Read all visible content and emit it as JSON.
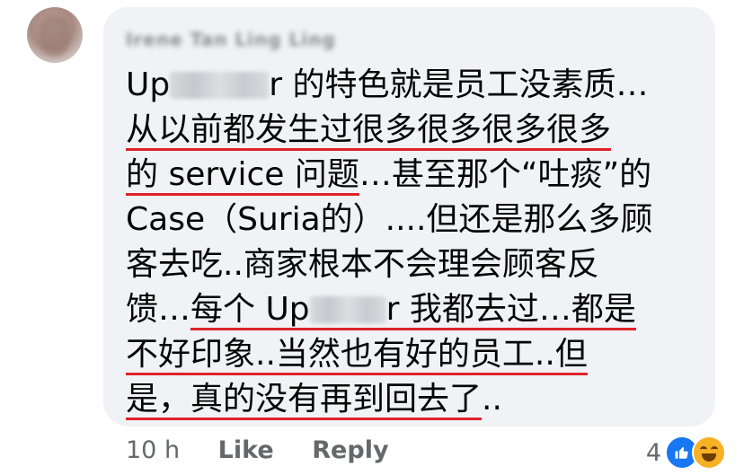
{
  "comment": {
    "author": "Irene Tan Ling Ling",
    "lines": [
      {
        "pre": "Up",
        "post": "r 的特色就是员工没素质…"
      },
      {
        "text": "从以前都发生过很多很多很多很多"
      },
      {
        "u": "的 service 问题",
        "rest": "…甚至那个“吐痰”的"
      },
      {
        "text": "Case（Suria的）....但还是那么多顾"
      },
      {
        "text": "客去吃..商家根本不会理会顾客反"
      },
      {
        "pre": "馈…",
        "u1": "每个 Up",
        "u2": "r 我都去过…都是"
      },
      {
        "u": "不好印象..当然也有好的员工..但",
        "rest": ""
      },
      {
        "u": "是，真的没有再到回去了",
        "rest": ".."
      }
    ]
  },
  "footer": {
    "time": "10 h",
    "like": "Like",
    "reply": "Reply"
  },
  "reactions": {
    "count": "4",
    "icons": [
      "like-icon",
      "haha-icon"
    ]
  },
  "colors": {
    "bubble": "#f0f2f5",
    "underline": "#e0222a",
    "meta": "#65676b",
    "like_blue": "#1877f2",
    "haha_yellow": "#f7b125"
  }
}
